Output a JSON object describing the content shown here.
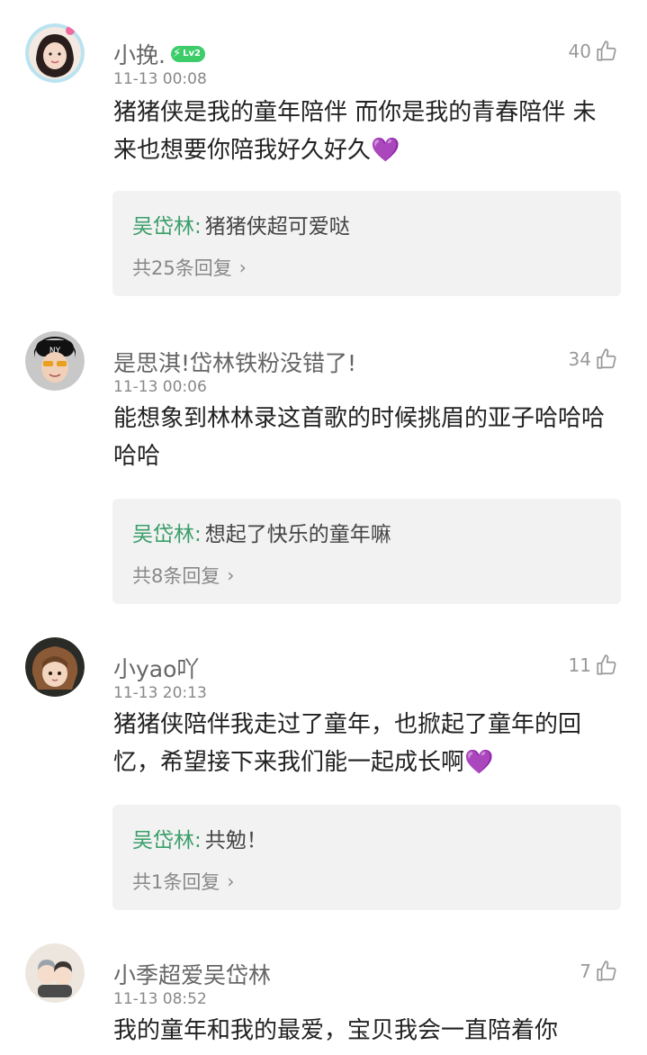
{
  "comments": [
    {
      "username": "小挽.",
      "level": "Lv2",
      "time": "11-13 00:08",
      "likes": "40",
      "text": "猪猪侠是我的童年陪伴 而你是我的青春陪伴 未来也想要你陪我好久好久",
      "emoji": "💜",
      "reply": {
        "author": "吴岱林",
        "content": "猪猪侠超可爱哒",
        "more": "共25条回复"
      }
    },
    {
      "username": "是思淇!岱林铁粉没错了!",
      "time": "11-13 00:06",
      "likes": "34",
      "text": "能想象到林林录这首歌的时候挑眉的亚子哈哈哈哈哈",
      "reply": {
        "author": "吴岱林",
        "content": "想起了快乐的童年嘛",
        "more": "共8条回复"
      }
    },
    {
      "username": "小yao吖",
      "time": "11-13 20:13",
      "likes": "11",
      "text": "猪猪侠陪伴我走过了童年，也掀起了童年的回忆，希望接下来我们能一起成长啊",
      "emoji": "💜",
      "reply": {
        "author": "吴岱林",
        "content": "共勉！",
        "more": "共1条回复"
      }
    },
    {
      "username": "小季超爱吴岱林",
      "time": "11-13 08:52",
      "likes": "7",
      "text": "我的童年和我的最爱，宝贝我会一直陪着你"
    }
  ],
  "colors": {
    "reply_author": "#3a9e6a",
    "badge": "#3dcc6a",
    "heart": "#7b2fc4",
    "reply_bg": "#f2f2f2"
  },
  "icons": {
    "like": "thumbs-up-icon",
    "chevron": "chevron-right-icon",
    "level": "lightning-icon"
  }
}
